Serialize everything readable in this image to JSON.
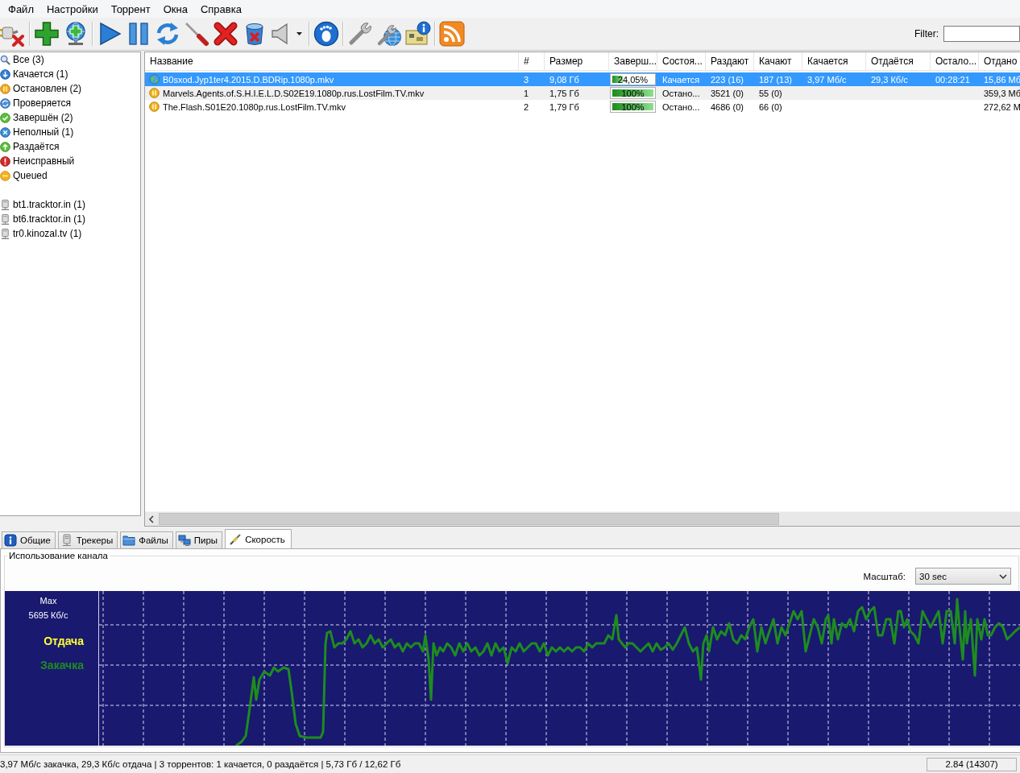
{
  "menu": [
    "Файл",
    "Настройки",
    "Торрент",
    "Окна",
    "Справка"
  ],
  "toolbar": {
    "filter_label": "Filter:"
  },
  "sidebar": {
    "statuses": [
      {
        "label": "Все (3)",
        "kind": "all"
      },
      {
        "label": "Качается (1)",
        "kind": "downloading"
      },
      {
        "label": "Остановлен (2)",
        "kind": "stopped"
      },
      {
        "label": "Проверяется",
        "kind": "checking"
      },
      {
        "label": "Завершён (2)",
        "kind": "completed"
      },
      {
        "label": "Неполный (1)",
        "kind": "incomplete"
      },
      {
        "label": "Раздаётся",
        "kind": "seeding"
      },
      {
        "label": "Неисправный",
        "kind": "error"
      },
      {
        "label": "Queued",
        "kind": "queued"
      }
    ],
    "trackers": [
      {
        "label": "bt1.tracktor.in (1)"
      },
      {
        "label": "bt6.tracktor.in (1)"
      },
      {
        "label": "tr0.kinozal.tv (1)"
      }
    ]
  },
  "table": {
    "columns": [
      "Название",
      "#",
      "Размер",
      "Заверш...",
      "Состоя...",
      "Раздают",
      "Качают",
      "Качается",
      "Отдаётся",
      "Остало...",
      "Отдано"
    ],
    "rows": [
      {
        "selected": true,
        "kind": "downloading",
        "name": "B0sxod.Jyp1ter4.2015.D.BDRip.1080p.mkv",
        "number": "3",
        "size": "9,08 Гб",
        "progress": {
          "level": 0.2405,
          "text": "24,05%"
        },
        "status": "Качается",
        "seeds": "223 (16)",
        "peers": "187 (13)",
        "down_speed": "3,97 Мб/с",
        "up_speed": "29,3 Кб/с",
        "remaining": "00:28:21",
        "uploaded": "15,86 Мб"
      },
      {
        "selected": false,
        "kind": "stopped",
        "name": "Marvels.Agents.of.S.H.I.E.L.D.S02E19.1080p.rus.LostFilm.TV.mkv",
        "number": "1",
        "size": "1,75 Гб",
        "progress": {
          "level": 1,
          "text": "100%"
        },
        "status": "Остано...",
        "seeds": "3521 (0)",
        "peers": "55 (0)",
        "uploaded": "359,3 Мб"
      },
      {
        "selected": false,
        "kind": "stopped",
        "name": "The.Flash.S01E20.1080p.rus.LostFilm.TV.mkv",
        "number": "2",
        "size": "1,79 Гб",
        "progress": {
          "level": 1,
          "text": "100%"
        },
        "status": "Остано...",
        "seeds": "4686 (0)",
        "peers": "66 (0)",
        "uploaded": "272,62 М"
      }
    ]
  },
  "details": {
    "tabs": [
      {
        "label": "Общие",
        "kind": "general",
        "selected": false
      },
      {
        "label": "Трекеры",
        "kind": "trackers",
        "selected": false
      },
      {
        "label": "Файлы",
        "kind": "files",
        "selected": false
      },
      {
        "label": "Пиры",
        "kind": "peers",
        "selected": false
      },
      {
        "label": "Скорость",
        "kind": "speed",
        "selected": true
      }
    ],
    "group_title": "Использование канала",
    "scale_label": "Масштаб:",
    "scale_value": "30 sec",
    "graph": {
      "max_label": "Max",
      "max_value": "5695 Кб/с",
      "legend": [
        {
          "label": "Отдача",
          "color": "#ffff33"
        },
        {
          "label": "Закачка",
          "color": "#1e8c1e"
        }
      ]
    }
  },
  "status_bar": {
    "text": "3,97 Мб/с закачка, 29,3 Кб/с отдача | 3 торрентов: 1 качается, 0 раздаётся | 5,73 Гб / 12,62 Гб",
    "ratio": "2.84 (14307)"
  }
}
